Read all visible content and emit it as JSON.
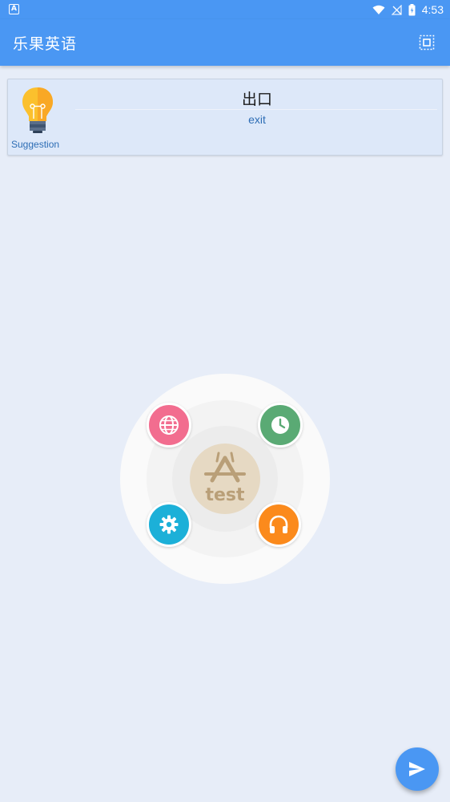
{
  "status_bar": {
    "left_icon": "A",
    "time": "4:53",
    "icons": [
      "wifi-icon",
      "no-signal-icon",
      "battery-icon"
    ]
  },
  "app_bar": {
    "title": "乐果英语",
    "action_icon": "select-all-icon"
  },
  "suggestion_card": {
    "icon": "lightbulb-icon",
    "label": "Suggestion",
    "word": "出口",
    "translation": "exit"
  },
  "radial_menu": {
    "center_text": "test",
    "buttons": [
      {
        "icon": "globe-icon",
        "color": "#f26d8f"
      },
      {
        "icon": "clock-icon",
        "color": "#5aaa74"
      },
      {
        "icon": "gear-icon",
        "color": "#1cb0d8"
      },
      {
        "icon": "headphones-icon",
        "color": "#fb8a1c"
      }
    ]
  },
  "fab": {
    "icon": "send-icon"
  },
  "colors": {
    "primary": "#4a97f3",
    "background": "#e7edf8",
    "card": "#dde8f9",
    "link_text": "#2d6db5"
  }
}
